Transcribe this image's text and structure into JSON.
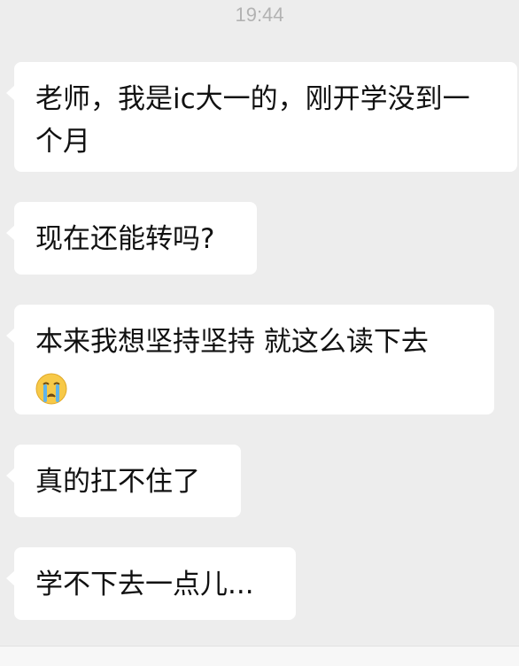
{
  "status": {
    "time": "19:44"
  },
  "messages": [
    {
      "text": "老师，我是ic大一的，刚开学没到一个月"
    },
    {
      "text": "现在还能转吗?"
    },
    {
      "text": "本来我想坚持坚持 就这么读下去",
      "emoji": "crying-face-emoji"
    },
    {
      "text": "真的扛不住了"
    },
    {
      "text": "学不下去一点儿..."
    }
  ],
  "colors": {
    "background": "#ededed",
    "bubble": "#ffffff",
    "text": "#111111",
    "timestamp": "#b2b2b2"
  }
}
